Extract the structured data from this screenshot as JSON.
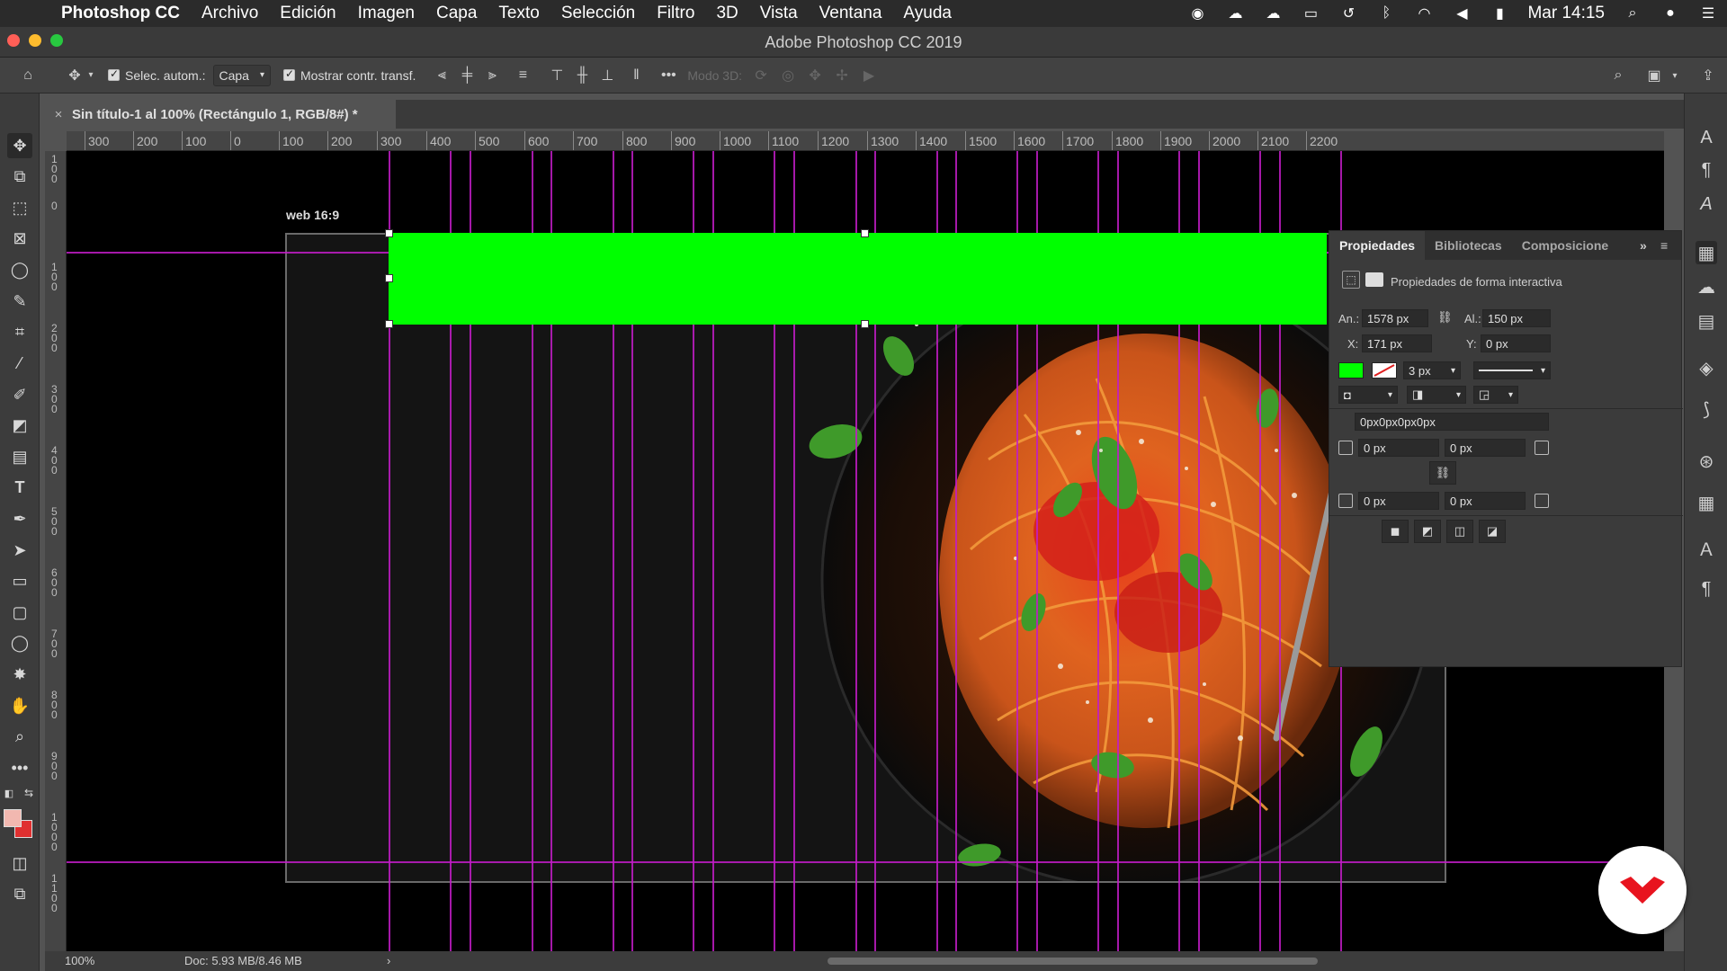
{
  "menubar": {
    "app_name": "Photoshop CC",
    "items": [
      "Archivo",
      "Edición",
      "Imagen",
      "Capa",
      "Texto",
      "Selección",
      "Filtro",
      "3D",
      "Vista",
      "Ventana",
      "Ayuda"
    ],
    "clock": "Mar 14:15",
    "status_icons": [
      "record-icon",
      "creative-cloud-icon",
      "cloud-icon",
      "display-icon",
      "time-machine-icon",
      "bluetooth-icon",
      "wifi-icon",
      "volume-icon",
      "battery-icon",
      "search-icon",
      "siri-icon",
      "notification-center-icon"
    ]
  },
  "window": {
    "title": "Adobe Photoshop CC 2019",
    "light_colors": [
      "#ff5f57",
      "#febc2e",
      "#28c840"
    ]
  },
  "options_bar": {
    "auto_select_label": "Selec. autom.:",
    "auto_select_checked": true,
    "auto_select_target": "Capa",
    "show_transform_label": "Mostrar contr. transf.",
    "show_transform_checked": true,
    "mode_3d_label": "Modo 3D:"
  },
  "document": {
    "tab_title": "Sin título-1 al 100% (Rectángulo 1, RGB/8#) *",
    "close_glyph": "×",
    "artboard_name": "web 16:9"
  },
  "ruler": {
    "horizontal_labels": [
      "0",
      "300",
      "200",
      "100",
      "0",
      "100",
      "200",
      "300",
      "400",
      "500",
      "600",
      "700",
      "800",
      "900",
      "1000",
      "1100",
      "1200",
      "1300",
      "1400",
      "1500",
      "1600",
      "1700",
      "1800",
      "1900",
      "2000",
      "2100",
      "2200"
    ],
    "vertical_labels": [
      "100",
      "0",
      "100",
      "200",
      "300",
      "400",
      "500",
      "600",
      "700",
      "800",
      "900",
      "1000",
      "1100"
    ]
  },
  "properties_panel": {
    "tabs": [
      "Propiedades",
      "Bibliotecas",
      "Composicione"
    ],
    "active_tab": "Propiedades",
    "section_title": "Propiedades de forma interactiva",
    "width_label": "An.:",
    "width_value": "1578 px",
    "height_label": "Al.:",
    "height_value": "150 px",
    "x_label": "X:",
    "x_value": "171 px",
    "y_label": "Y:",
    "y_value": "0 px",
    "fill_color": "#00ff00",
    "stroke_width": "3 px",
    "corner_radii_summary": "0px0px0px0px",
    "corner_top_left": "0 px",
    "corner_top_right": "0 px",
    "corner_bottom_left": "0 px",
    "corner_bottom_right": "0 px"
  },
  "status_bar": {
    "zoom": "100%",
    "doc_size": "Doc: 5.93 MB/8.46 MB",
    "arrow": "›"
  },
  "colors": {
    "foreground": "#f2b8b0",
    "background": "#e03030",
    "guide": "#c21cc7",
    "shape_fill": "#00ff00",
    "badge_logo": "#e8141f"
  }
}
